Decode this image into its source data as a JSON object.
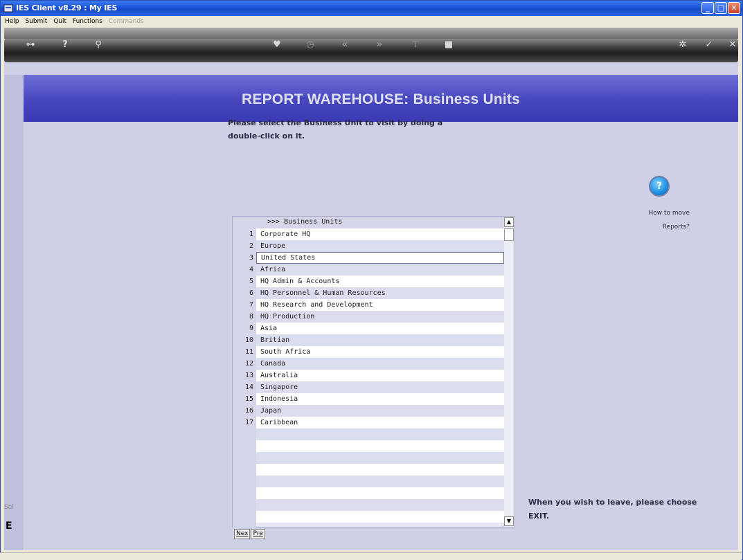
{
  "window": {
    "title": "IES Client v8.29 : My IES"
  },
  "menu": [
    {
      "label": "Help",
      "enabled": true
    },
    {
      "label": "Submit",
      "enabled": true
    },
    {
      "label": "Quit",
      "enabled": true
    },
    {
      "label": "Functions",
      "enabled": true
    },
    {
      "label": "Commands",
      "enabled": false
    }
  ],
  "toolbar": {
    "icons": [
      "key-icon",
      "help-icon",
      "search-icon",
      "heart-icon",
      "clock-icon",
      "rewind-icon",
      "fast-forward-icon",
      "insert-icon",
      "stop-icon",
      "gear-icon",
      "checkmark-icon",
      "close-icon"
    ]
  },
  "header": {
    "title": "REPORT WAREHOUSE:  Business Units"
  },
  "instructions": {
    "line1": "Please select the Business Unit to visit by doing a",
    "line2": "double-click on it."
  },
  "help": {
    "symbol": "?",
    "line1": "How to move",
    "line2": "Reports?"
  },
  "list": {
    "header": ">>> Business Units",
    "selected_index": 3,
    "rows": [
      {
        "num": "1",
        "label": "Corporate HQ"
      },
      {
        "num": "2",
        "label": "Europe"
      },
      {
        "num": "3",
        "label": "United States"
      },
      {
        "num": "4",
        "label": "Africa"
      },
      {
        "num": "5",
        "label": "HQ Admin & Accounts"
      },
      {
        "num": "6",
        "label": "HQ Personnel & Human Resources"
      },
      {
        "num": "7",
        "label": "HQ Research and Development"
      },
      {
        "num": "8",
        "label": "HQ Production"
      },
      {
        "num": "9",
        "label": "Asia"
      },
      {
        "num": "10",
        "label": "Britian"
      },
      {
        "num": "11",
        "label": "South Africa"
      },
      {
        "num": "12",
        "label": "Canada"
      },
      {
        "num": "13",
        "label": "Australia"
      },
      {
        "num": "14",
        "label": "Singapore"
      },
      {
        "num": "15",
        "label": "Indonesia"
      },
      {
        "num": "16",
        "label": "Japan"
      },
      {
        "num": "17",
        "label": "Caribbean"
      }
    ]
  },
  "nav": {
    "next": "Nex",
    "prev": "Pre"
  },
  "leave": {
    "line1": "When you wish to leave, please choose",
    "line2": "EXIT."
  },
  "side": {
    "sel": "Sel",
    "e": "E"
  }
}
